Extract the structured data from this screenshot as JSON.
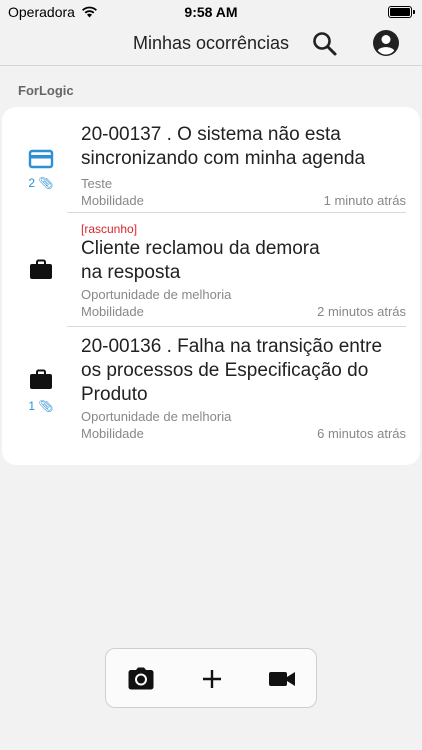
{
  "status": {
    "carrier": "Operadora",
    "time": "9:58 AM"
  },
  "header": {
    "title": "Minhas ocorrências"
  },
  "section": {
    "label": "ForLogic"
  },
  "items": [
    {
      "icon": "credit-card-icon",
      "attachments": "2",
      "draft": "",
      "title_line1": "20-00137 . O sistema não esta",
      "title_line2": "sincronizando com minha agenda",
      "title_line3": "",
      "category": "Teste",
      "area": "Mobilidade",
      "time": "1 minuto atrás"
    },
    {
      "icon": "briefcase-icon",
      "attachments": "",
      "draft": "[rascunho]",
      "title_line1": "Cliente reclamou da demora",
      "title_line2": "na resposta",
      "title_line3": "",
      "category": "Oportunidade de melhoria",
      "area": "Mobilidade",
      "time": "2 minutos atrás"
    },
    {
      "icon": "briefcase-icon",
      "attachments": "1",
      "draft": "",
      "title_line1": "20-00136 . Falha na transição entre",
      "title_line2": "os processos de Especificação do",
      "title_line3": "Produto",
      "category": "Oportunidade de melhoria",
      "area": "Mobilidade",
      "time": "6 minutos atrás"
    }
  ],
  "actions": [
    "camera-icon",
    "plus-icon",
    "video-camera-icon"
  ],
  "colors": {
    "accent": "#2d8fd5",
    "draft": "#d9262b",
    "background": "#f2f2f2"
  }
}
